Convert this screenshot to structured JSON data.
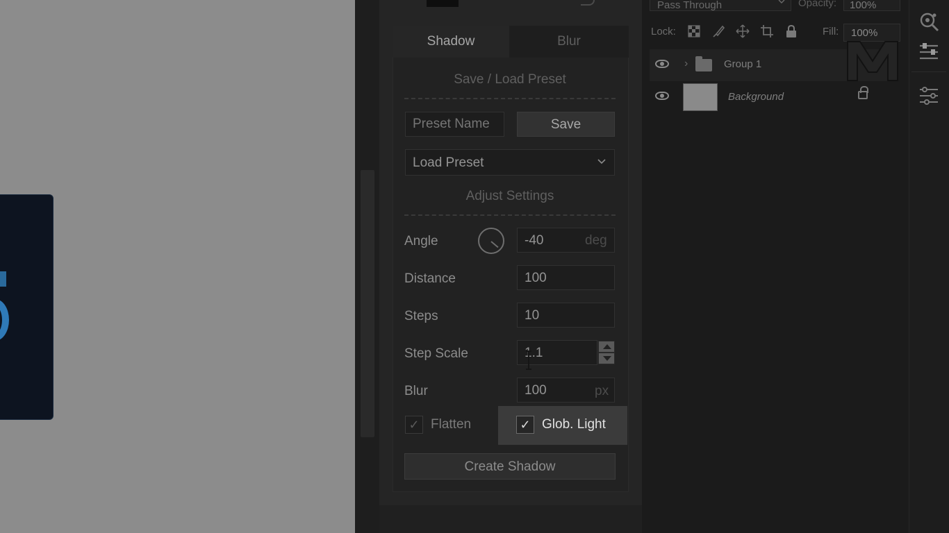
{
  "plugin": {
    "tabs": [
      {
        "label": "Shadow",
        "active": true
      },
      {
        "label": "Blur",
        "active": false
      }
    ],
    "save_load_title": "Save / Load Preset",
    "preset_name_placeholder": "Preset Name",
    "save_label": "Save",
    "load_preset_label": "Load Preset",
    "adjust_title": "Adjust Settings",
    "settings": {
      "angle": {
        "label": "Angle",
        "value": "-40",
        "unit": "deg"
      },
      "distance": {
        "label": "Distance",
        "value": "100"
      },
      "steps": {
        "label": "Steps",
        "value": "10"
      },
      "step_scale": {
        "label": "Step Scale",
        "value": "1.1"
      },
      "blur": {
        "label": "Blur",
        "value": "100",
        "unit": "px"
      }
    },
    "flatten": {
      "label": "Flatten",
      "checked": true,
      "mark": "✓"
    },
    "glob_light": {
      "label": "Glob. Light",
      "checked": true,
      "mark": "✓"
    },
    "create_label": "Create Shadow"
  },
  "layers": {
    "blend_mode": "Pass Through",
    "opacity_label": "Opacity:",
    "opacity_value": "100%",
    "lock_label": "Lock:",
    "fill_label": "Fill:",
    "fill_value": "100%",
    "items": [
      {
        "name": "Group 1",
        "type": "group",
        "visible": true,
        "chevron": "›"
      },
      {
        "name": "Background",
        "type": "raster",
        "visible": true,
        "locked": true
      }
    ]
  },
  "colors": {
    "canvas": "#8c8c8c",
    "panel": "#252525",
    "highlight": "#3b3b3b",
    "doc_accent": "#2f7ab8"
  }
}
